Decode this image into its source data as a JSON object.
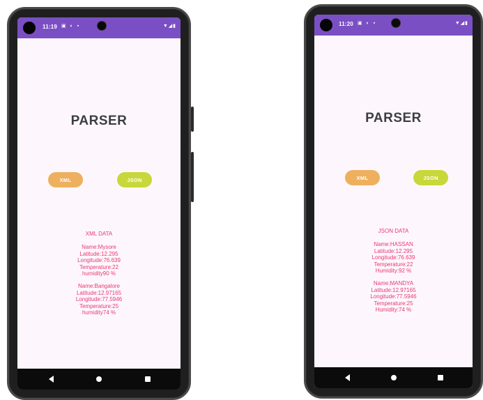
{
  "phones": [
    {
      "status_time": "11:19",
      "status_icons": "▣ ◐ ▪",
      "status_right": "▼◢▮",
      "title": "PARSER",
      "xml_button": "XML",
      "json_button": "JSON",
      "output_heading": "XML DATA",
      "records": [
        [
          "Name:Mysore",
          "Latitude:12.295",
          "Longitude:76.639",
          "Temperature:22",
          "humidity90 %"
        ],
        [
          "Name:Bangalore",
          "Latitude:12.97165",
          "Longitude:77.5946",
          "Temperature:25",
          "humidity74 %"
        ]
      ]
    },
    {
      "status_time": "11:20",
      "status_icons": "▣ ◐ ▪",
      "status_right": "▼◢▮",
      "title": "PARSER",
      "xml_button": "XML",
      "json_button": "JSON",
      "output_heading": "JSON DATA",
      "records": [
        [
          "Name:HASSAN",
          "Latitude:12.295",
          "Longitude:76.639",
          "Temperature:22",
          "Humidity:92 %"
        ],
        [
          "Name:MANDYA",
          "Latitude:12.97165",
          "Longitude:77.5946",
          "Temperature:25",
          "Humidity:74 %"
        ]
      ]
    }
  ],
  "colors": {
    "status_bar": "#7b4fc4",
    "xml_button": "#eeb05e",
    "json_button": "#c8d73a",
    "output_text": "#e8386e",
    "title_text": "#3d3d45"
  },
  "nav_icons": [
    "back-icon",
    "home-icon",
    "recents-icon"
  ]
}
